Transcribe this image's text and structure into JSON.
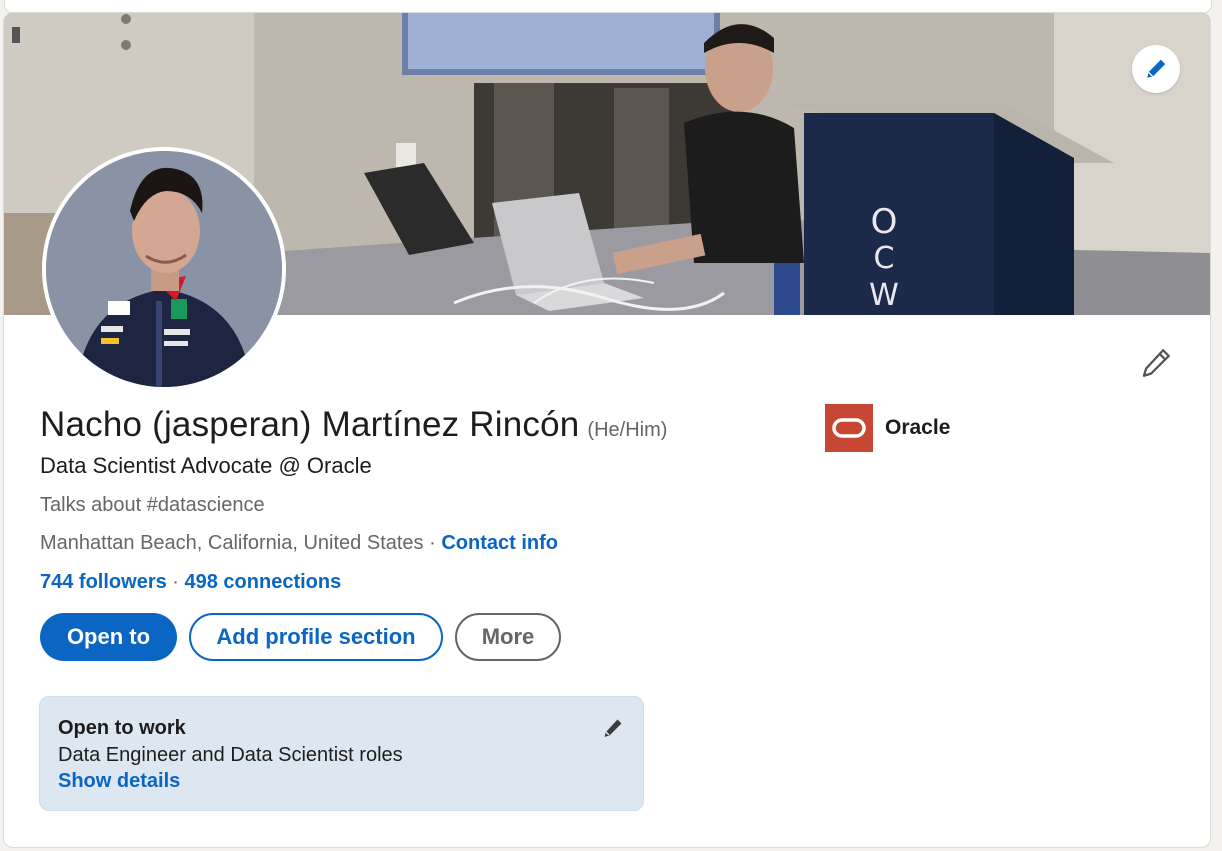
{
  "profile": {
    "name": "Nacho (jasperan) Martínez Rincón",
    "pronouns": "(He/Him)",
    "headline": "Data Scientist Advocate @ Oracle",
    "talks_about": "Talks about #datascience",
    "location": "Manhattan Beach, California, United States",
    "separator": " · ",
    "contact_info_label": "Contact info",
    "followers_label": "744 followers",
    "connections_separator": " · ",
    "connections_label": "498 connections"
  },
  "company": {
    "name": "Oracle",
    "logo_color": "#c74634"
  },
  "actions": {
    "open_to_label": "Open to",
    "add_section_label": "Add profile section",
    "more_label": "More"
  },
  "open_to_work": {
    "title": "Open to work",
    "roles": "Data Engineer and Data Scientist roles",
    "show_details_label": "Show details"
  },
  "banner": {
    "podium_text": "O C W"
  },
  "icons": {
    "banner_edit": "pencil-icon",
    "intro_edit": "pencil-icon",
    "open_to_work_edit": "pencil-icon"
  },
  "colors": {
    "brand_blue": "#0a66c2",
    "card_bg": "#ffffff",
    "page_bg": "#f3f2ef",
    "open_to_work_bg": "#dde7f1"
  }
}
